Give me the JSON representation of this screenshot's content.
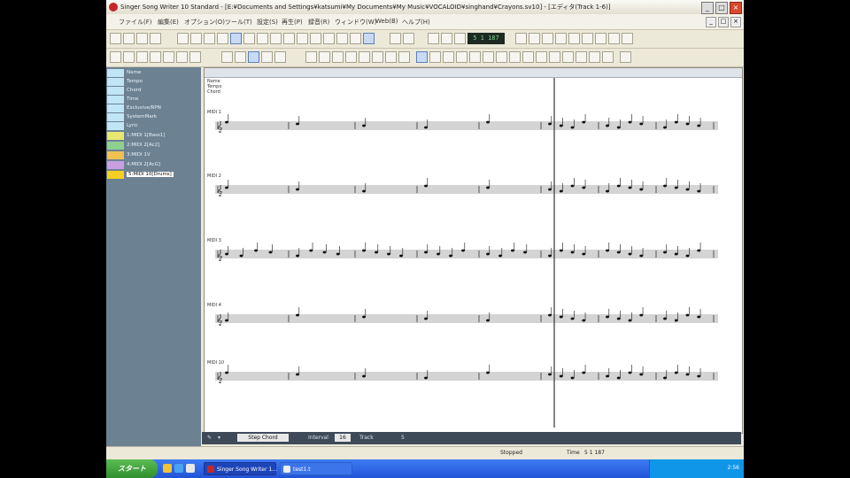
{
  "window": {
    "title": "Singer Song Writer 10 Standard - [E:¥Documents and Settings¥katsumi¥My Documents¥My Music¥VOCALOID¥singhand¥Crayons.sv10] - [エディタ(Track 1-6)]",
    "controls": {
      "minimize": "_",
      "maximize": "□",
      "close": "×"
    }
  },
  "menu": [
    "ファイル(F)",
    "編集(E)",
    "オプション(O)",
    "ツール(T)",
    "設定(S)",
    "再生(P)",
    "録音(R)",
    "ウィンドウ(W)",
    "Web(B)",
    "ヘルプ(H)"
  ],
  "transport": {
    "time": "5 1 187"
  },
  "tracks": [
    {
      "label": "Name"
    },
    {
      "label": "Tempo"
    },
    {
      "label": "Chord"
    },
    {
      "label": "Time"
    },
    {
      "label": "Exclusive/RPN"
    },
    {
      "label": "SystemMark"
    },
    {
      "label": "Lyric"
    },
    {
      "label": "1:MIDI 1[Bass1]",
      "color": "#e8e870"
    },
    {
      "label": "2:MIDI 2[Ac2]",
      "color": "#8fd08f"
    },
    {
      "label": "3:MIDI 1V",
      "color": "#f0c050"
    },
    {
      "label": "4:MIDI 2[AcG]",
      "color": "#c8a0e0"
    },
    {
      "label": "5:MIDI 10[Drums]",
      "color": "#f5d020",
      "selected": true
    }
  ],
  "score_header": [
    "Name",
    "Tempo",
    "Chord"
  ],
  "staves": [
    {
      "label": "MIDI 1"
    },
    {
      "label": "MIDI 2"
    },
    {
      "label": "MIDI 3"
    },
    {
      "label": "MIDI 4"
    },
    {
      "label": "MIDI 10"
    }
  ],
  "editor_status": {
    "mode": "Step Chord",
    "interval_label": "Interval",
    "interval_value": "16",
    "track_label": "Track",
    "track_value": "5"
  },
  "statusbar": {
    "status": "Stopped",
    "position_label": "Time",
    "position": "5 1 187"
  },
  "taskbar": {
    "start": "スタート",
    "tasks": [
      {
        "label": "Singer Song Writer 1..."
      },
      {
        "label": "test1.t"
      }
    ],
    "clock": "2:56"
  },
  "colors": {
    "track_panel": "#6c8191",
    "selected_label": "#ffffff",
    "cursor": "#333333"
  }
}
